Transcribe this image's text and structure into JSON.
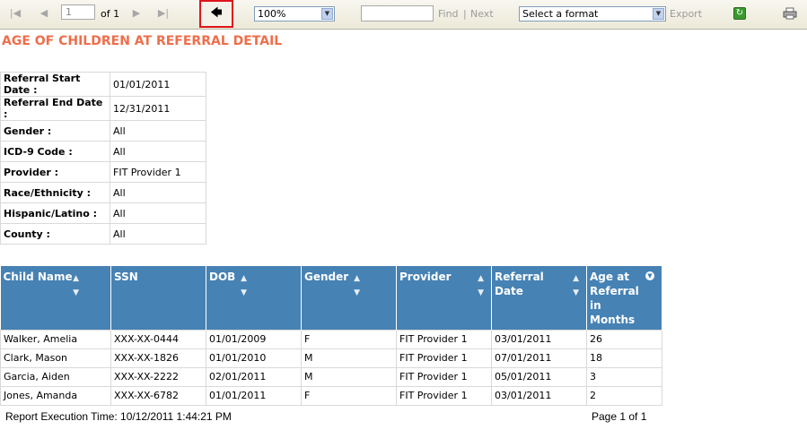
{
  "toolbar": {
    "page_value": "1",
    "of_label": "of 1",
    "zoom_value": "100%",
    "find_label": "Find",
    "separator": "|",
    "next_label": "Next",
    "format_value": "Select a format",
    "export_label": "Export"
  },
  "report": {
    "title": "AGE OF CHILDREN AT REFERRAL DETAIL",
    "params": [
      {
        "label": "Referral Start Date :",
        "value": "01/01/2011"
      },
      {
        "label": "Referral End Date :",
        "value": "12/31/2011"
      },
      {
        "label": "Gender :",
        "value": "All"
      },
      {
        "label": "ICD-9 Code :",
        "value": "All"
      },
      {
        "label": "Provider :",
        "value": "FIT Provider 1"
      },
      {
        "label": "Race/Ethnicity :",
        "value": "All"
      },
      {
        "label": "Hispanic/Latino :",
        "value": "All"
      },
      {
        "label": "County :",
        "value": "All"
      }
    ],
    "columns": [
      "Child Name",
      "SSN",
      "DOB",
      "Gender",
      "Provider",
      "Referral Date",
      "Age at Referral in Months"
    ],
    "rows": [
      [
        "Walker, Amelia",
        "XXX-XX-0444",
        "01/01/2009",
        "F",
        "FIT Provider 1",
        "03/01/2011",
        "26"
      ],
      [
        "Clark, Mason",
        "XXX-XX-1826",
        "01/01/2010",
        "M",
        "FIT Provider 1",
        "07/01/2011",
        "18"
      ],
      [
        "Garcia, Aiden",
        "XXX-XX-2222",
        "02/01/2011",
        "M",
        "FIT Provider 1",
        "05/01/2011",
        "3"
      ],
      [
        "Jones, Amanda",
        "XXX-XX-6782",
        "01/01/2011",
        "F",
        "FIT Provider 1",
        "03/01/2011",
        "2"
      ]
    ],
    "execution_time": "Report Execution Time: 10/12/2011 1:44:21 PM",
    "page_info": "Page 1 of 1"
  }
}
